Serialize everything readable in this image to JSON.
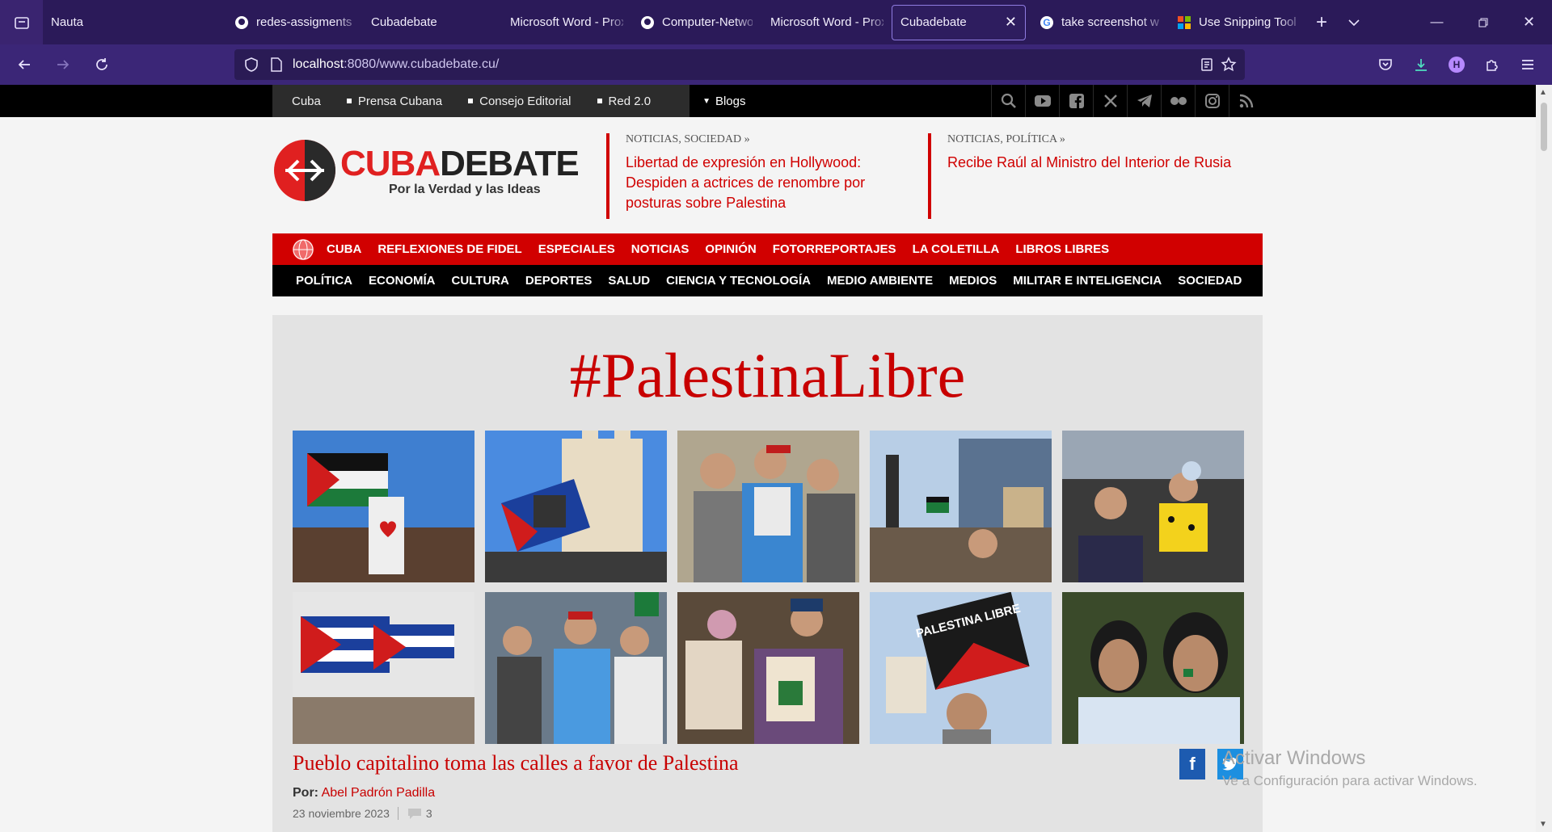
{
  "browser": {
    "tabs": [
      {
        "title": "Nauta",
        "icon": "tab-list-icon"
      },
      {
        "title": "redes-assigments",
        "icon": "github-icon"
      },
      {
        "title": "Cubadebate",
        "icon": "blank-page-icon"
      },
      {
        "title": "Microsoft Word - Proxy",
        "icon": "blank-page-icon"
      },
      {
        "title": "Computer-Networks",
        "icon": "github-icon"
      },
      {
        "title": "Microsoft Word - Proxy",
        "icon": "blank-page-icon"
      },
      {
        "title": "Cubadebate",
        "icon": "blank-page-icon",
        "active": true
      },
      {
        "title": "take screenshot w",
        "icon": "google-icon"
      },
      {
        "title": "Use Snipping Tool",
        "icon": "microsoft-icon"
      }
    ],
    "url_host": "localhost",
    "url_rest": ":8080/www.cubadebate.cu/",
    "profile_initial": "H"
  },
  "site": {
    "top_links": [
      "Cuba",
      "Prensa Cubana",
      "Consejo Editorial",
      "Red 2.0"
    ],
    "blogs_label": "Blogs",
    "social_icons": [
      "search-icon",
      "youtube-icon",
      "facebook-icon",
      "x-icon",
      "telegram-icon",
      "flickr-icon",
      "instagram-icon",
      "rss-icon"
    ],
    "logo": {
      "cuba": "CUBA",
      "debate": "DEBATE",
      "tagline": "Por la Verdad y las Ideas"
    },
    "headlines": [
      {
        "kicker": "NOTICIAS, SOCIEDAD  »",
        "title": "Libertad de expresión en Hollywood: Despiden a actrices de renombre por posturas sobre Palestina"
      },
      {
        "kicker": "NOTICIAS, POLÍTICA  »",
        "title": "Recibe Raúl al Ministro del Interior de Rusia"
      }
    ],
    "menu_primary": [
      "CUBA",
      "REFLEXIONES DE FIDEL",
      "ESPECIALES",
      "NOTICIAS",
      "OPINIÓN",
      "FOTORREPORTAJES",
      "LA COLETILLA",
      "LIBROS LIBRES"
    ],
    "menu_secondary": [
      "POLÍTICA",
      "ECONOMÍA",
      "CULTURA",
      "DEPORTES",
      "SALUD",
      "CIENCIA Y TECNOLOGÍA",
      "MEDIO AMBIENTE",
      "MEDIOS",
      "MILITAR E INTELIGENCIA",
      "SOCIEDAD"
    ],
    "feature": {
      "hashtag": "#PalestinaLibre",
      "photo_sign_text": "PALESTINA LIBRE",
      "article_title": "Pueblo capitalino toma las calles a favor de Palestina",
      "byline_prefix": "Por:",
      "author": "Abel Padrón Padilla",
      "date": "23 noviembre 2023",
      "comments": "3"
    },
    "share_icons": [
      "facebook-share-icon",
      "twitter-share-icon"
    ]
  },
  "os_watermark": {
    "line1": "Activar Windows",
    "line2": "Ve a Configuración para activar Windows."
  },
  "colors": {
    "brand_red": "#d10000",
    "browser_purple": "#2b1a59"
  }
}
